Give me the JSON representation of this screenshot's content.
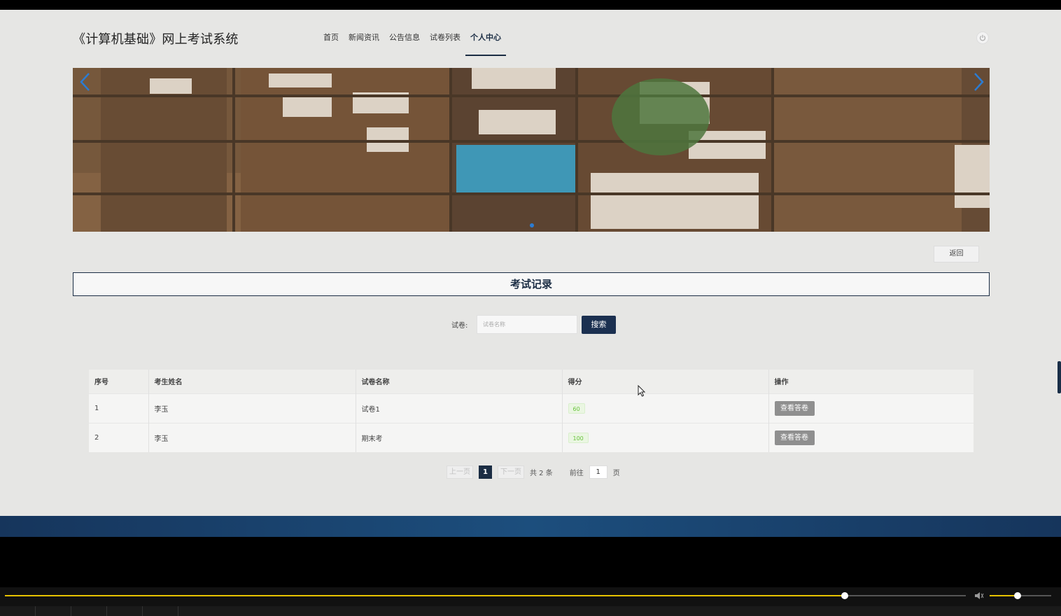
{
  "header": {
    "site_title": "《计算机基础》网上考试系统",
    "nav": [
      {
        "label": "首页",
        "active": false
      },
      {
        "label": "新闻资讯",
        "active": false
      },
      {
        "label": "公告信息",
        "active": false
      },
      {
        "label": "试卷列表",
        "active": false
      },
      {
        "label": "个人中心",
        "active": true
      }
    ],
    "power_icon": "power-icon"
  },
  "banner": {
    "prev_icon": "chevron-left-icon",
    "next_icon": "chevron-right-icon",
    "slide_count": 1,
    "active_slide": 1
  },
  "back_label": "返回",
  "section_title": "考试记录",
  "search": {
    "label": "试卷:",
    "placeholder": "试卷名称",
    "button": "搜索"
  },
  "table": {
    "columns": [
      "序号",
      "考生姓名",
      "试卷名称",
      "得分",
      "操作"
    ],
    "rows": [
      {
        "index": "1",
        "name": "李玉",
        "paper": "试卷1",
        "score": "60",
        "action": "查看答卷"
      },
      {
        "index": "2",
        "name": "李玉",
        "paper": "期末考",
        "score": "100",
        "action": "查看答卷"
      }
    ]
  },
  "pagination": {
    "prev": "上一页",
    "current": "1",
    "next": "下一页",
    "total": "共 2 条",
    "goto": "前往",
    "goto_value": "1",
    "page_suffix": "页"
  },
  "player": {
    "progress": 0.874,
    "volume": 0.45,
    "volume_icon": "speaker-icon"
  },
  "colors": {
    "accent": "#1b2d44",
    "progress": "#e6c200",
    "score_tag": "#67c23a"
  }
}
